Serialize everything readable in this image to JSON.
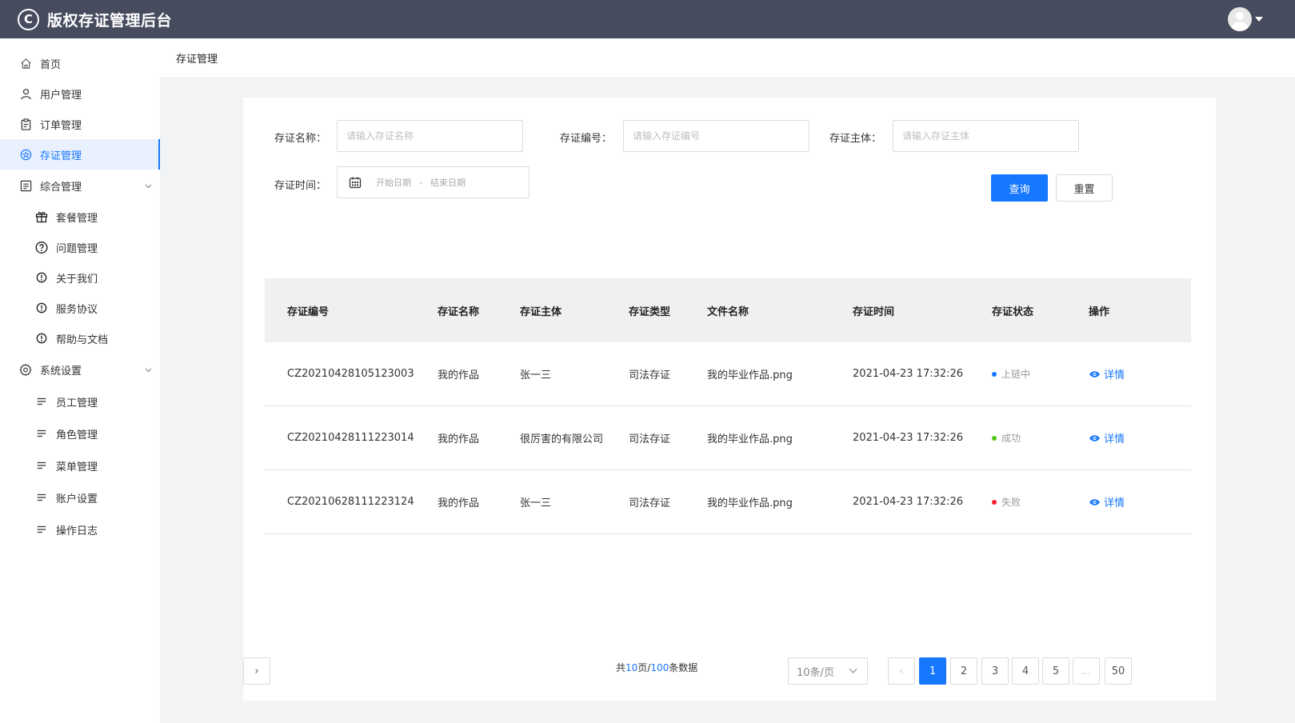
{
  "app": {
    "logo_glyph": "C",
    "title": "版权存证管理后台"
  },
  "breadcrumb": "存证管理",
  "sidebar": {
    "items": [
      {
        "label": "首页",
        "icon": "home-icon"
      },
      {
        "label": "用户管理",
        "icon": "user-icon"
      },
      {
        "label": "订单管理",
        "icon": "clipboard-icon"
      },
      {
        "label": "存证管理",
        "icon": "star-badge-icon",
        "active": true
      },
      {
        "label": "综合管理",
        "icon": "list-icon",
        "expandable": true
      },
      {
        "label": "套餐管理",
        "icon": "gift-icon"
      },
      {
        "label": "问题管理",
        "icon": "question-icon"
      },
      {
        "label": "关于我们",
        "icon": "info-icon"
      },
      {
        "label": "服务协议",
        "icon": "info-icon"
      },
      {
        "label": "帮助与文档",
        "icon": "info-icon"
      },
      {
        "label": "系统设置",
        "icon": "gear-icon",
        "expandable": true
      },
      {
        "label": "员工管理",
        "icon": "lines-icon"
      },
      {
        "label": "角色管理",
        "icon": "lines-icon"
      },
      {
        "label": "菜单管理",
        "icon": "lines-icon"
      },
      {
        "label": "账户设置",
        "icon": "lines-icon"
      },
      {
        "label": "操作日志",
        "icon": "lines-icon"
      }
    ]
  },
  "filters": {
    "name_label": "存证名称：",
    "name_placeholder": "请输入存证名称",
    "number_label": "存证编号：",
    "number_placeholder": "请输入存证编号",
    "subject_label": "存证主体：",
    "subject_placeholder": "请输入存证主体",
    "time_label": "存证时间：",
    "start_placeholder": "开始日期",
    "range_sep": "-",
    "end_placeholder": "结束日期",
    "search_button": "查询",
    "reset_button": "重置"
  },
  "table": {
    "columns": [
      "存证编号",
      "存证名称",
      "存证主体",
      "存证类型",
      "文件名称",
      "存证时间",
      "存证状态",
      "操作"
    ],
    "rows": [
      {
        "id": "CZ20210428105123003",
        "name": "我的作品",
        "subject": "张一三",
        "type": "司法存证",
        "file": "我的毕业作品.png",
        "time": "2021-04-23 17:32:26",
        "status": "上链中",
        "status_color": "#1677ff",
        "action": "详情"
      },
      {
        "id": "CZ20210428111223014",
        "name": "我的作品",
        "subject": "很厉害的有限公司",
        "type": "司法存证",
        "file": "我的毕业作品.png",
        "time": "2021-04-23 17:32:26",
        "status": "成功",
        "status_color": "#52c41a",
        "action": "详情"
      },
      {
        "id": "CZ20210628111223124",
        "name": "我的作品",
        "subject": "张一三",
        "type": "司法存证",
        "file": "我的毕业作品.png",
        "time": "2021-04-23 17:32:26",
        "status": "失败",
        "status_color": "#f5222d",
        "action": "详情"
      }
    ]
  },
  "pagination": {
    "info_prefix": "共",
    "total_pages": "10",
    "info_mid": "页/",
    "total_items": "100",
    "info_suffix": "条数据",
    "page_size": "10条/页",
    "prev": "‹",
    "pages": [
      "1",
      "2",
      "3",
      "4",
      "5",
      "...",
      "50"
    ],
    "current": "1",
    "next": "›"
  },
  "colors": {
    "header_bg": "#464b5e",
    "primary": "#1677ff"
  }
}
